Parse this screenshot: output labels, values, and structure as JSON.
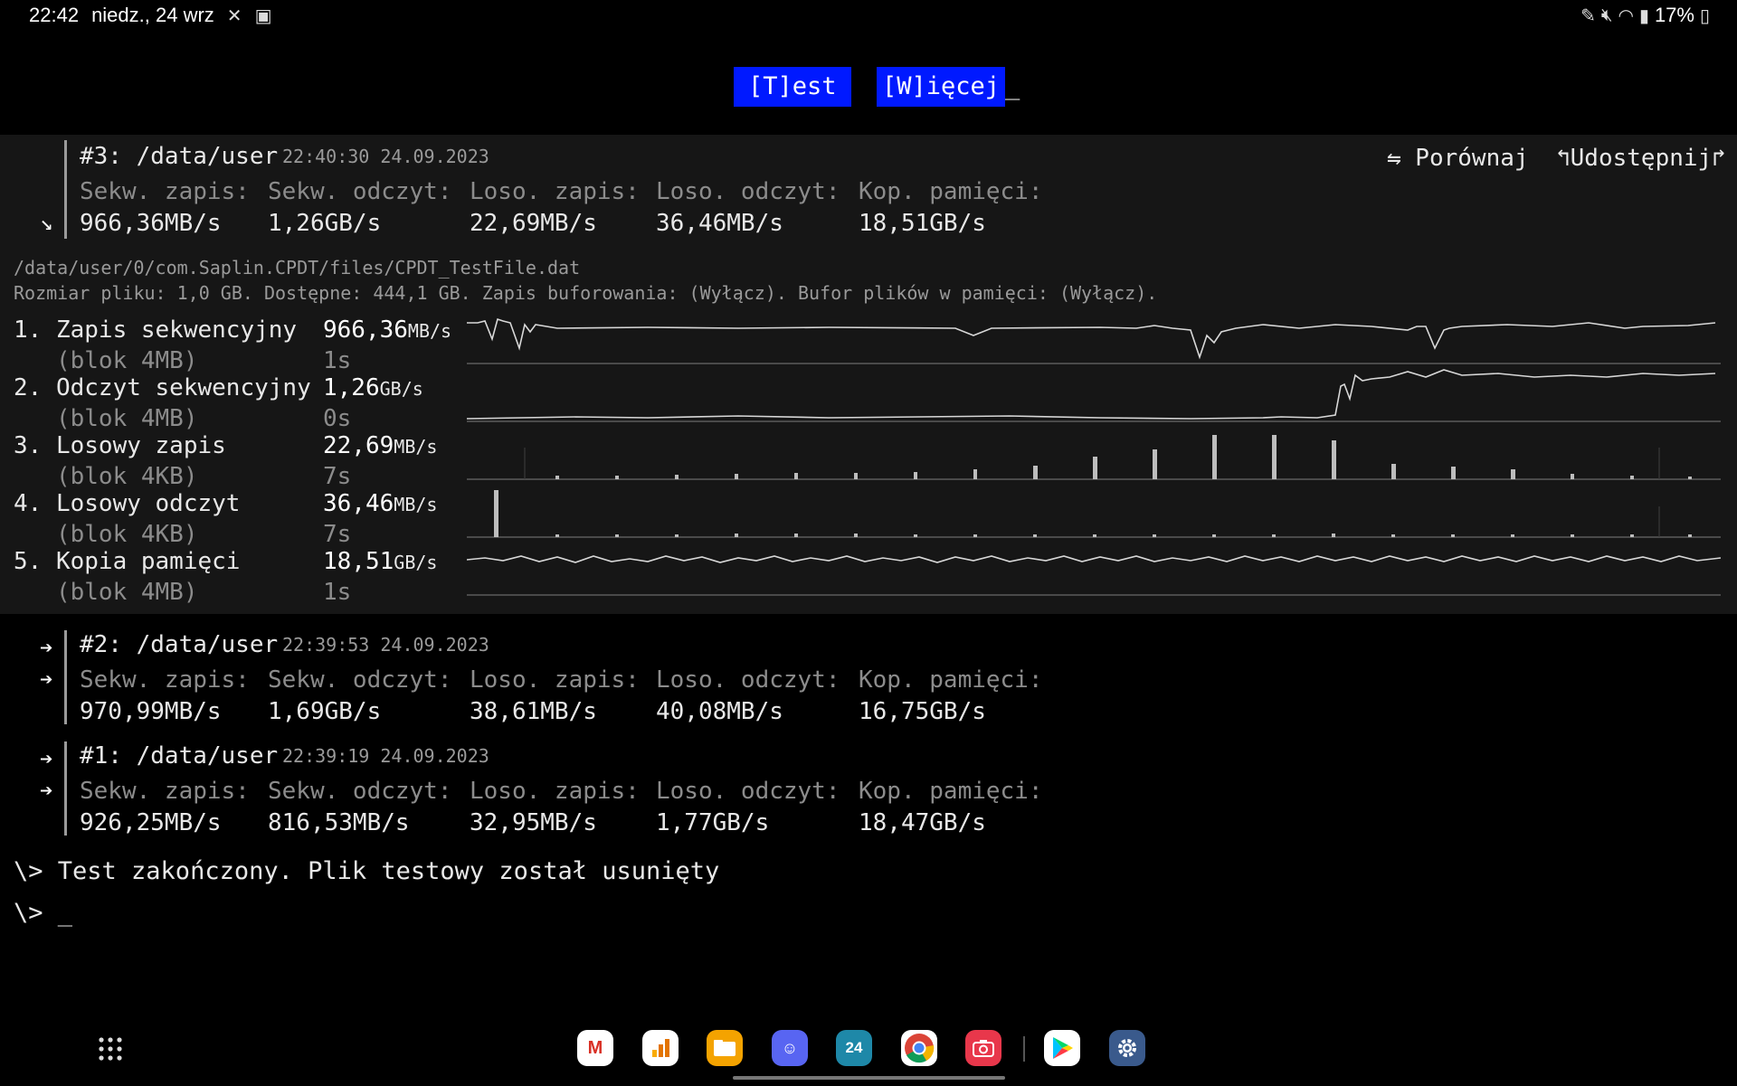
{
  "status_bar": {
    "time": "22:42",
    "date": "niedz., 24 wrz",
    "battery": "17%"
  },
  "toolbar": {
    "test_label": "[T]est",
    "more_label": "[W]ięcej",
    "cursor": "_"
  },
  "labels": {
    "seq_write": "Sekw. zapis:",
    "seq_read": "Sekw. odczyt:",
    "rand_write": "Loso. zapis:",
    "rand_read": "Loso. odczyt:",
    "mem_copy": "Kop. pamięci:"
  },
  "actions": {
    "compare": "⇋ Porównaj",
    "share": "↰Udostępnij↱"
  },
  "results": [
    {
      "title": "#3: /data/user",
      "timestamp": "22:40:30 24.09.2023",
      "seq_write": "966,36MB/s",
      "seq_read": "1,26GB/s",
      "rand_write": "22,69MB/s",
      "rand_read": "36,46MB/s",
      "mem_copy": "18,51GB/s"
    },
    {
      "title": "#2: /data/user",
      "timestamp": "22:39:53 24.09.2023",
      "seq_write": "970,99MB/s",
      "seq_read": "1,69GB/s",
      "rand_write": "38,61MB/s",
      "rand_read": "40,08MB/s",
      "mem_copy": "16,75GB/s"
    },
    {
      "title": "#1: /data/user",
      "timestamp": "22:39:19 24.09.2023",
      "seq_write": "926,25MB/s",
      "seq_read": "816,53MB/s",
      "rand_write": "32,95MB/s",
      "rand_read": "1,77GB/s",
      "mem_copy": "18,47GB/s"
    }
  ],
  "details": {
    "file_path": "/data/user/0/com.Saplin.CPDT/files/CPDT_TestFile.dat",
    "file_info": "Rozmiar pliku: 1,0 GB. Dostępne: 444,1 GB. Zapis buforowania: (Wyłącz). Bufor plików w pamięci: (Wyłącz)."
  },
  "tests": [
    {
      "name": "1. Zapis sekwencyjny",
      "block": "   (blok 4MB)",
      "value": "966,36",
      "unit": "MB/s",
      "duration": "1s"
    },
    {
      "name": "2. Odczyt sekwencyjny",
      "block": "   (blok 4MB)",
      "value": "1,26",
      "unit": "GB/s",
      "duration": "0s"
    },
    {
      "name": "3. Losowy zapis",
      "block": "   (blok 4KB)",
      "value": "22,69",
      "unit": "MB/s",
      "duration": "7s"
    },
    {
      "name": "4. Losowy odczyt",
      "block": "   (blok 4KB)",
      "value": "36,46",
      "unit": "MB/s",
      "duration": "7s"
    },
    {
      "name": "5. Kopia pamięci",
      "block": "   (blok 4MB)",
      "value": "18,51",
      "unit": "GB/s",
      "duration": "1s"
    }
  ],
  "console": {
    "line1": "\\> Test zakończony. Plik testowy został usunięty",
    "line2": "\\> _"
  },
  "dock": {
    "calendar_day": "24",
    "apps": [
      "gmail-icon",
      "analytics-icon",
      "files-icon",
      "discord-icon",
      "calendar-icon",
      "chrome-icon",
      "camera-icon",
      "play-store-icon",
      "settings-icon"
    ]
  }
}
